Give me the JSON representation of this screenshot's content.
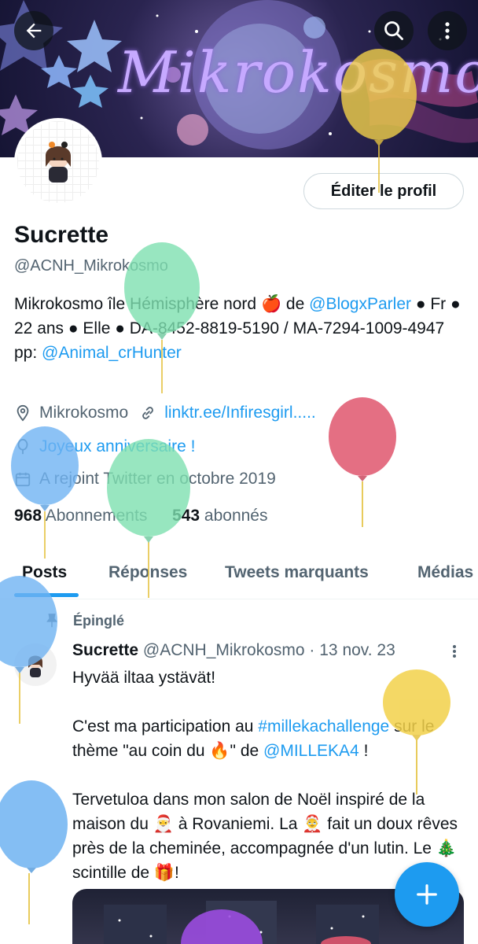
{
  "banner": {
    "title": "Mikrokosmo"
  },
  "header": {
    "back_icon": "arrow-left-icon",
    "search_icon": "search-icon",
    "more_icon": "more-vertical-icon"
  },
  "profile": {
    "edit_label": "Éditer le profil",
    "name": "Sucrette",
    "handle": "@ACNH_Mikrokosmo",
    "bio": {
      "part1": "Mikrokosmo île Hémisphère nord 🍎 de ",
      "mention1": "@BlogxParler",
      "part2": " ● Fr ● 22 ans ● Elle ● DA-8452-8819-5190 / MA-7294-1009-4947 pp: ",
      "mention2": "@Animal_crHunter"
    },
    "location": "Mikrokosmo",
    "website": "linktr.ee/Infiresgirl.....",
    "birthday": "Joyeux anniversaire !",
    "joined": "A rejoint Twitter en octobre 2019",
    "following_count": "968",
    "following_label": "Abonnements",
    "followers_count": "543",
    "followers_label": "abonnés"
  },
  "tabs": [
    "Posts",
    "Réponses",
    "Tweets marquants",
    "Médias"
  ],
  "tweet": {
    "pinned_label": "Épinglé",
    "author_name": "Sucrette",
    "author_handle": "@ACNH_Mikrokosmo",
    "dot": "·",
    "date": "13 nov. 23",
    "line1": "Hyvää iltaa ystävät!",
    "p2_a": "C'est ma participation au ",
    "p2_tag": "#millekachallenge",
    "p2_b": " sur le thème \"au coin du 🔥\" de ",
    "p2_mention": "@MILLEKA4",
    "p2_c": " !",
    "p3": "Tervetuloa dans mon salon de Noël inspiré de la maison du 🎅 à Rovaniemi.  La 🤶 fait un doux rêves près de la cheminée, accompagnée d'un lutin. Le 🎄 scintille de 🎁!"
  },
  "colors": {
    "accent": "#1d9bf0",
    "text": "#0f1419",
    "secondary": "#536471",
    "balloon_green": "#7ee0b0",
    "balloon_blue": "#6fb3f2",
    "balloon_yellow": "#f2d14a",
    "balloon_red": "#e0566e",
    "balloon_purple": "#9b4de0"
  }
}
